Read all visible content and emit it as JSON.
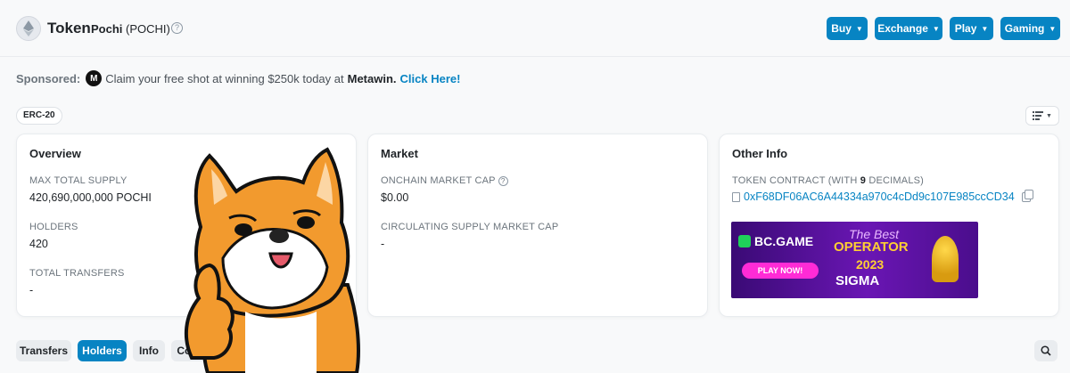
{
  "header": {
    "token_label": "Token",
    "token_name": "Pochi",
    "token_symbol": "(POCHI)",
    "help_icon": "question-circle-icon",
    "buttons": [
      {
        "label": "Buy"
      },
      {
        "label": "Exchange"
      },
      {
        "label": "Play"
      },
      {
        "label": "Gaming"
      }
    ]
  },
  "sponsored": {
    "label": "Sponsored:",
    "logo_text": "M",
    "text": "Claim your free shot at winning $250k today at",
    "brand": "Metawin.",
    "cta": "Click Here!"
  },
  "badge": "ERC-20",
  "view_toggle_icon": "list-filter-icon",
  "overview": {
    "title": "Overview",
    "max_supply_label": "MAX TOTAL SUPPLY",
    "max_supply_value": "420,690,000,000 POCHI",
    "holders_label": "HOLDERS",
    "holders_value": "420",
    "transfers_label": "TOTAL TRANSFERS",
    "transfers_value": "-"
  },
  "market": {
    "title": "Market",
    "onchain_cap_label": "ONCHAIN MARKET CAP",
    "onchain_cap_value": "$0.00",
    "circ_cap_label": "CIRCULATING SUPPLY MARKET CAP",
    "circ_cap_value": "-"
  },
  "other_info": {
    "title": "Other Info",
    "contract_label_prefix": "TOKEN CONTRACT (WITH",
    "decimals": "9",
    "contract_label_suffix": "DECIMALS)",
    "contract_address": "0xF68DF06AC6A44334a970c4cDd9c107E985ccCD34",
    "ad": {
      "brand": "BC.GAME",
      "play": "PLAY NOW!",
      "best": "The Best",
      "operator": "OPERATOR",
      "year": "2023",
      "sigma": "SIGMA"
    }
  },
  "tabs": [
    {
      "label": "Transfers",
      "active": false
    },
    {
      "label": "Holders",
      "active": true
    },
    {
      "label": "Info",
      "active": false
    },
    {
      "label": "Cont",
      "active": false
    }
  ],
  "colors": {
    "accent": "#0784c3",
    "background": "#f8f9fa",
    "mascot_orange": "#f29a2e"
  }
}
